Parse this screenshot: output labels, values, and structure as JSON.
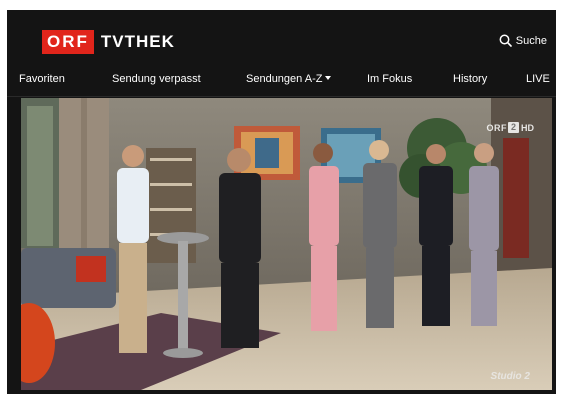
{
  "brand": {
    "logo_box": "ORF",
    "logo_text": "TVTHEK",
    "logo_color": "#e1251b"
  },
  "header": {
    "search_label": "Suche",
    "search_icon": "search-icon"
  },
  "nav": {
    "items": [
      {
        "label": "Favoriten"
      },
      {
        "label": "Sendung verpasst"
      },
      {
        "label": "Sendungen A-Z",
        "has_dropdown": true
      },
      {
        "label": "Im Fokus"
      },
      {
        "label": "History"
      },
      {
        "label": "LIVE"
      }
    ]
  },
  "video": {
    "channel_bug": {
      "prefix": "ORF",
      "number": "2",
      "suffix": "HD"
    },
    "studio_logo": "Studio 2"
  },
  "colors": {
    "background": "#141414",
    "text": "#ffffff"
  }
}
